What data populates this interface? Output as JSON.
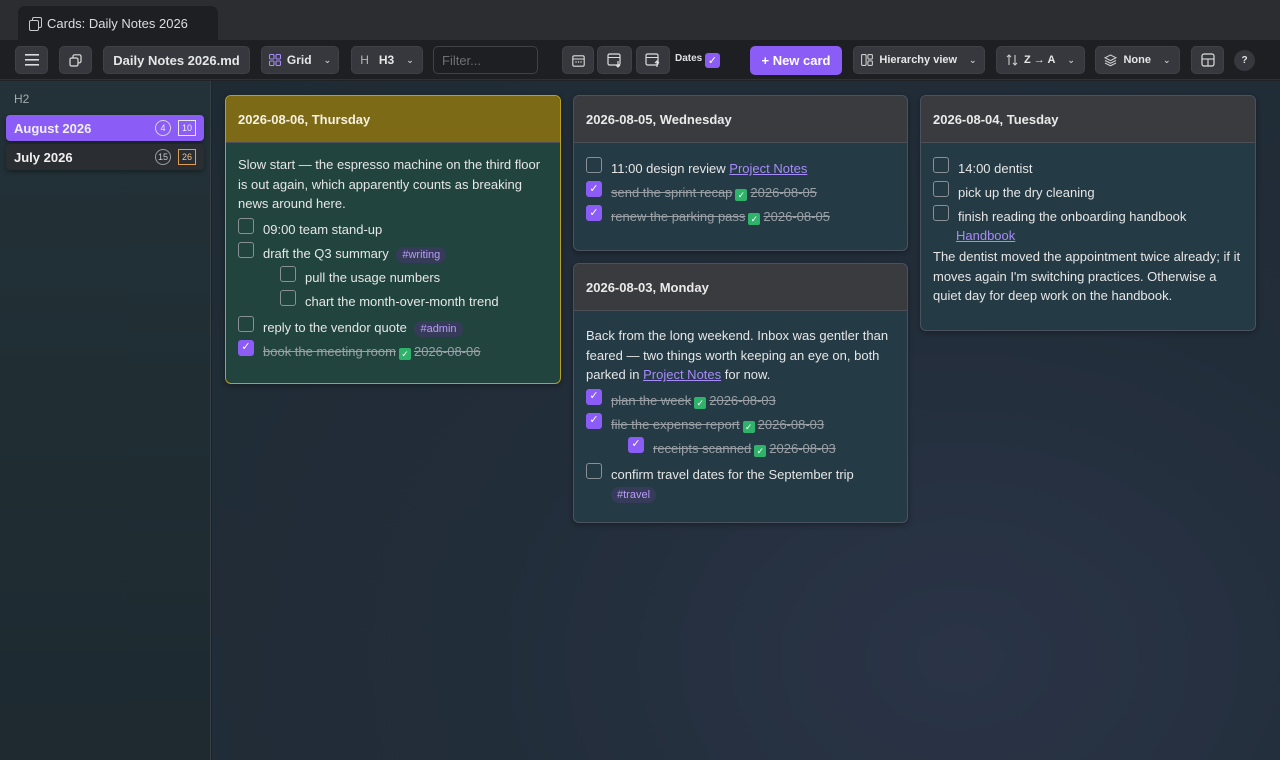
{
  "window": {
    "tab_title": "Cards: Daily Notes 2026"
  },
  "toolbar": {
    "file_name": "Daily Notes 2026.md",
    "layout_label": "Grid",
    "heading_prefix": "H",
    "heading_label": "H3",
    "filter_placeholder": "Filter...",
    "dates_label": "Dates",
    "dates_checked": true,
    "new_card_label": "+ New card",
    "hierarchy_label": "Hierarchy view",
    "sort_label": "Z → A",
    "group_label": "None",
    "help_label": "?"
  },
  "sidebar": {
    "heading": "H2",
    "items": [
      {
        "label": "August 2026",
        "count": "4",
        "total": "10",
        "active": true
      },
      {
        "label": "July 2026",
        "count": "15",
        "total": "26",
        "active": false
      }
    ]
  },
  "cards": {
    "thursday": {
      "title": "2026-08-06, Thursday",
      "paragraph": "Slow start — the espresso machine on the third floor is out again, which apparently counts as breaking news around here.",
      "tasks": [
        {
          "text": "09:00 team stand-up",
          "done": false
        },
        {
          "text": "draft the Q3 summary",
          "tag": "#writing",
          "done": false
        },
        {
          "text": "pull the usage numbers",
          "done": false
        },
        {
          "text": "chart the month-over-month trend",
          "done": false
        },
        {
          "text": "reply to the vendor quote",
          "tag": "#admin",
          "done": false
        },
        {
          "text": "book the meeting room",
          "date": "2026-08-06",
          "done": true
        }
      ]
    },
    "wednesday": {
      "title": "2026-08-05, Wednesday",
      "tasks": [
        {
          "text": "11:00 design review",
          "link": "Project Notes",
          "done": false
        },
        {
          "text": "send the sprint recap",
          "date": "2026-08-05",
          "done": true
        },
        {
          "text": "renew the parking pass",
          "date": "2026-08-05",
          "done": true
        }
      ]
    },
    "monday": {
      "title": "2026-08-03, Monday",
      "paragraph_before": "Back from the long weekend. Inbox was gentler than feared — two things worth keeping an eye on, both parked in",
      "paragraph_link": "Project Notes",
      "paragraph_after": "for now.",
      "tasks": [
        {
          "text": "plan the week",
          "date": "2026-08-03",
          "done": true
        },
        {
          "text": "file the expense report",
          "date": "2026-08-03",
          "done": true
        },
        {
          "text": "receipts scanned",
          "date": "2026-08-03",
          "done": true
        },
        {
          "text": "confirm travel dates for the September trip",
          "tag": "#travel",
          "done": false
        }
      ]
    },
    "tuesday": {
      "title": "2026-08-04, Tuesday",
      "tasks": [
        {
          "text": "14:00 dentist",
          "done": false
        },
        {
          "text": "pick up the dry cleaning",
          "done": false
        },
        {
          "text": "finish reading the onboarding handbook",
          "link": "Handbook",
          "done": false
        }
      ],
      "paragraph": "The dentist moved the appointment twice already; if it moves again I'm switching practices. Otherwise a quiet day for deep work on the handbook."
    }
  },
  "colors": {
    "accent": "#8b5cf6",
    "today_header": "#7c6a16",
    "done_check": "#2fb36b"
  }
}
